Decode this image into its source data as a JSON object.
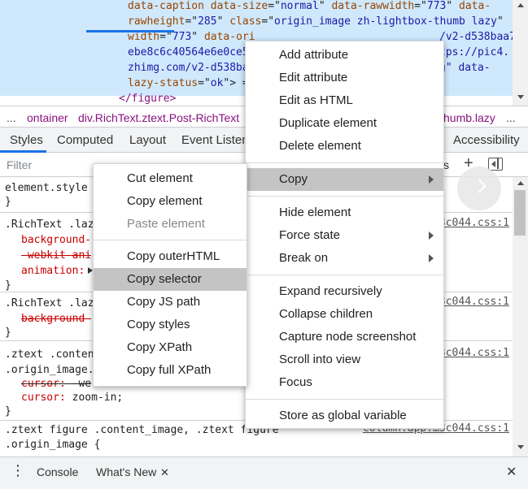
{
  "dom": {
    "lines": [
      [
        {
          "t": "data-caption",
          "c": "attr"
        },
        {
          "t": " ",
          "c": "plain"
        },
        {
          "t": "data-size",
          "c": "attr"
        },
        {
          "t": "=\"",
          "c": "plain"
        },
        {
          "t": "normal",
          "c": "val"
        },
        {
          "t": "\" ",
          "c": "plain"
        },
        {
          "t": "data-rawwidth",
          "c": "attr"
        },
        {
          "t": "=\"",
          "c": "plain"
        },
        {
          "t": "773",
          "c": "val"
        },
        {
          "t": "\" ",
          "c": "plain"
        },
        {
          "t": "data-",
          "c": "attr"
        }
      ],
      [
        {
          "t": "rawheight",
          "c": "attr"
        },
        {
          "t": "=\"",
          "c": "plain"
        },
        {
          "t": "285",
          "c": "val"
        },
        {
          "t": "\" ",
          "c": "plain"
        },
        {
          "t": "class",
          "c": "attr"
        },
        {
          "t": "=\"",
          "c": "plain"
        },
        {
          "t": "origin_image zh-lightbox-thumb lazy",
          "c": "val"
        },
        {
          "t": "\"",
          "c": "plain"
        }
      ],
      [
        {
          "t": "width",
          "c": "attr"
        },
        {
          "t": "=\"",
          "c": "plain"
        },
        {
          "t": "773",
          "c": "val"
        },
        {
          "t": "\" ",
          "c": "plain"
        },
        {
          "t": "data-ori",
          "c": "attr"
        }
      ],
      [
        {
          "t": "ebe8c6c40564e6e0ce5",
          "c": "val"
        }
      ],
      [
        {
          "t": "zhimg.com/v2-d538ba",
          "c": "val"
        }
      ],
      [
        {
          "t": "lazy-status",
          "c": "attr"
        },
        {
          "t": "=\"",
          "c": "plain"
        },
        {
          "t": "ok",
          "c": "val"
        },
        {
          "t": "\"> =",
          "c": "plain"
        }
      ],
      [
        {
          "t": "</figure>",
          "c": "tag"
        }
      ]
    ],
    "line_right_fragments": [
      {
        "text": "/v2-d538baa7",
        "line": 2
      },
      {
        "text": "tps://pic4.",
        "line": 3
      },
      {
        "text": "g\" data-",
        "line": 4
      }
    ]
  },
  "breadcrumb": {
    "more": "...",
    "items": [
      "ontainer",
      "div.RichText.ztext.Post-RichText",
      "humb.lazy"
    ],
    "trailing": "..."
  },
  "tabs": {
    "items": [
      "Styles",
      "Computed",
      "Layout",
      "Event Listene",
      "Accessibility"
    ],
    "active": "Styles"
  },
  "filter": {
    "placeholder": "Filter",
    "right_text": "s",
    "plus": "+"
  },
  "styles": {
    "rules": [
      {
        "lines": [
          {
            "t": "element.style",
            "c": "plain"
          },
          {
            "t": "}",
            "c": "plain"
          }
        ]
      },
      {
        "selector": ".RichText .laz",
        "source": "3c044.css:1",
        "props": [
          {
            "name": "background-",
            "ov": false
          },
          {
            "name": "-webkit-ani",
            "ov": true
          },
          {
            "name": "animation:",
            "ov": false
          }
        ],
        "close": "}"
      },
      {
        "selector": ".RichText .laz",
        "source": "3c044.css:1",
        "props": [
          {
            "name": "background-",
            "ov": true
          }
        ],
        "close": "}"
      },
      {
        "selector_lines": [
          ".ztext .conten",
          ".origin_image."
        ],
        "source": "3c044.css:1",
        "props_full": [
          {
            "name": "cursor:",
            "value": " -we",
            "ov": true
          },
          {
            "name": "cursor:",
            "value": " zoom-in;",
            "ov": false
          }
        ],
        "close": "}"
      },
      {
        "selector_lines": [
          ".ztext figure .content_image, .ztext figure",
          ".origin_image {"
        ],
        "source": "column.app.…3c044.css:1"
      }
    ]
  },
  "main_menu": {
    "items": [
      {
        "label": "Add attribute",
        "group": 0
      },
      {
        "label": "Edit attribute",
        "group": 0
      },
      {
        "label": "Edit as HTML",
        "group": 0
      },
      {
        "label": "Duplicate element",
        "group": 0
      },
      {
        "label": "Delete element",
        "group": 0
      },
      {
        "label": "Copy",
        "group": 1,
        "submenu": true,
        "highlighted": true
      },
      {
        "label": "Hide element",
        "group": 2
      },
      {
        "label": "Force state",
        "group": 2,
        "submenu": true
      },
      {
        "label": "Break on",
        "group": 2,
        "submenu": true
      },
      {
        "label": "Expand recursively",
        "group": 3
      },
      {
        "label": "Collapse children",
        "group": 3
      },
      {
        "label": "Capture node screenshot",
        "group": 3
      },
      {
        "label": "Scroll into view",
        "group": 3
      },
      {
        "label": "Focus",
        "group": 3
      },
      {
        "label": "Store as global variable",
        "group": 4
      }
    ]
  },
  "copy_menu": {
    "items": [
      {
        "label": "Cut element",
        "group": 0
      },
      {
        "label": "Copy element",
        "group": 0
      },
      {
        "label": "Paste element",
        "group": 0,
        "disabled": true
      },
      {
        "label": "Copy outerHTML",
        "group": 1
      },
      {
        "label": "Copy selector",
        "group": 1,
        "highlighted": true
      },
      {
        "label": "Copy JS path",
        "group": 1
      },
      {
        "label": "Copy styles",
        "group": 1
      },
      {
        "label": "Copy XPath",
        "group": 1
      },
      {
        "label": "Copy full XPath",
        "group": 1
      }
    ]
  },
  "drawer": {
    "tabs": [
      {
        "label": "Console",
        "active": false
      },
      {
        "label": "What's New",
        "active": true,
        "closable": true
      }
    ],
    "close_glyph": "✕",
    "tab_close_glyph": "✕",
    "menu_glyph": "⋮"
  },
  "colors": {
    "selection": "#cfe8fc",
    "attr": "#994500",
    "value": "#1a1aa6",
    "tag": "#881280",
    "property": "#c80000",
    "accent": "#1a73e8",
    "menu_highlight": "#c4c4c4"
  },
  "icons": {
    "dock": "dock-sidebar-icon",
    "more": "more-tabs-icon",
    "kebab": "kebab-menu-icon",
    "close": "close-icon",
    "submenu": "submenu-arrow-icon",
    "expand": "chevron-right-icon"
  }
}
